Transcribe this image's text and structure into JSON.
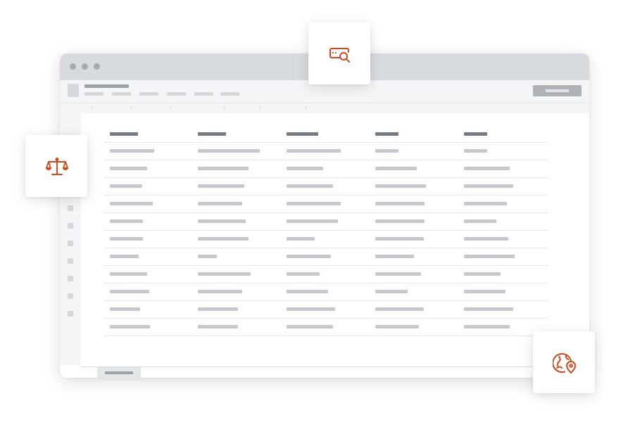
{
  "window": {
    "title_bar_dots": [
      "close",
      "minimize",
      "maximize"
    ],
    "toolbar": {
      "menu_items": 6,
      "action_button": "primary-action"
    },
    "tabs_count": 6,
    "sidebar_icons": 7,
    "table": {
      "columns": 5,
      "rows": 11
    }
  },
  "feature_cards": [
    {
      "icon": "message-search-icon",
      "color": "#d4471a"
    },
    {
      "icon": "scales-icon",
      "color": "#d4471a"
    },
    {
      "icon": "globe-location-icon",
      "color": "#d4471a"
    }
  ],
  "colors": {
    "accent": "#d4471a",
    "titlebar": "#d7dade",
    "header_placeholder": "#737a82",
    "cell_placeholder": "#c5c9ce"
  }
}
